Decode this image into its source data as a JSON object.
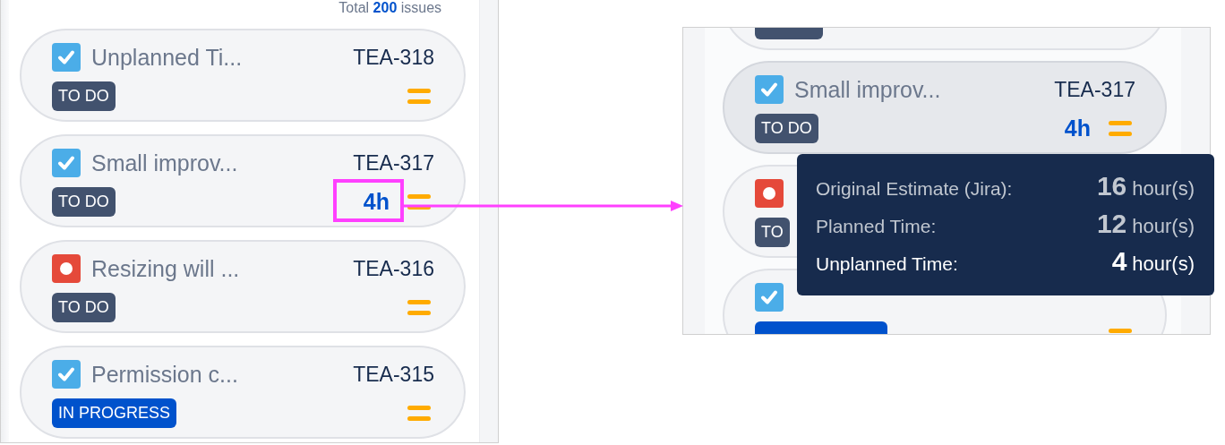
{
  "left_panel": {
    "summary": "Total **200** issues",
    "cards": [
      {
        "kind": "task",
        "title": "Unplanned Ti...",
        "key": "TEA-318",
        "status": {
          "label": "TO DO",
          "color": "#42526e"
        },
        "priority": {
          "kind": "medium"
        },
        "hovered": false
      },
      {
        "kind": "task",
        "title": "Small improv...",
        "key": "TEA-317",
        "status": {
          "label": "TO DO",
          "color": "#42526e"
        },
        "estimate": "4h",
        "priority": {
          "kind": "medium"
        },
        "hovered": false
      },
      {
        "kind": "bug",
        "title": "Resizing will ...",
        "key": "TEA-316",
        "status": {
          "label": "TO DO",
          "color": "#42526e"
        },
        "priority": {
          "kind": "medium"
        },
        "hovered": false
      },
      {
        "kind": "task",
        "title": "Permission c...",
        "key": "TEA-315",
        "status": {
          "label": "IN PROGRESS",
          "color": "#0052cc"
        },
        "priority": {
          "kind": "medium"
        },
        "hovered": false
      }
    ]
  },
  "right_panel": {
    "cards": [
      {
        "status": {
          "color": "#42526e"
        },
        "hovered": false
      },
      {
        "kind": "task",
        "title": "Small improv...",
        "key": "TEA-317",
        "status": {
          "label": "TO DO",
          "color": "#42526e"
        },
        "estimate": "4h",
        "priority": {
          "kind": "medium"
        },
        "hovered": true
      },
      {
        "kind": "bug",
        "status": {
          "label": "TO",
          "color": "#42526e"
        },
        "hovered": false
      },
      {
        "kind": "task",
        "status": {
          "color": "#0052cc"
        },
        "priority": {
          "kind": "medium"
        },
        "hovered": false
      }
    ],
    "tooltip": {
      "rows": [
        {
          "label": "Original Estimate (Jira):",
          "value": "16",
          "unit": "hour(s)",
          "highlighted": false
        },
        {
          "label": "Planned Time:",
          "value": "12",
          "unit": "hour(s)",
          "highlighted": false
        },
        {
          "label": "Unplanned Time:",
          "value": "4",
          "unit": "hour(s)",
          "highlighted": true
        }
      ]
    }
  }
}
